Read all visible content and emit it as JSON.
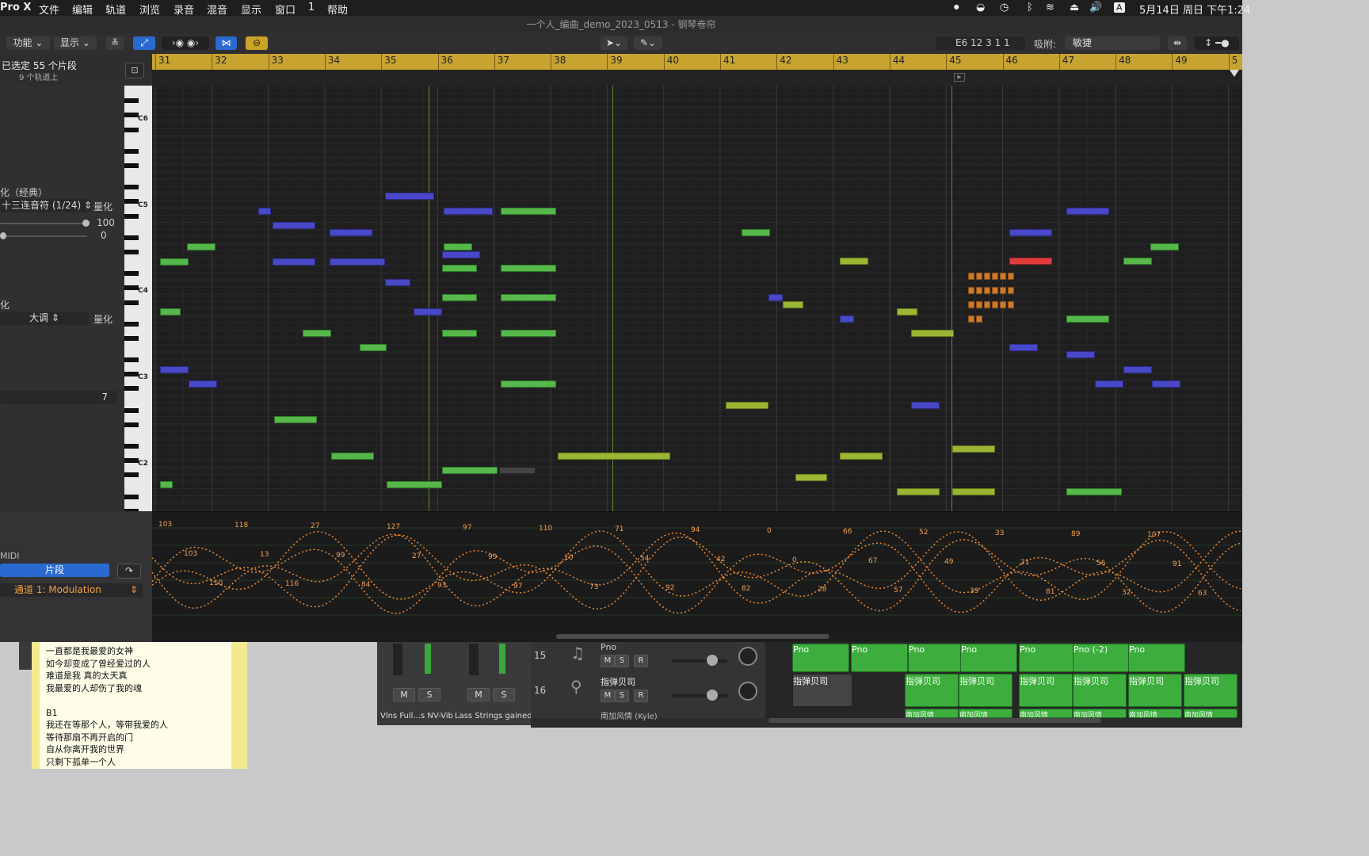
{
  "menubar": {
    "app": "Pro X",
    "items": [
      "文件",
      "编辑",
      "轨道",
      "浏览",
      "录音",
      "混音",
      "显示",
      "窗口",
      "1",
      "帮助"
    ],
    "status_icons": [
      "record-icon",
      "location-icon",
      "time-machine-icon",
      "bluetooth-icon",
      "wifi-icon",
      "eject-icon",
      "volume-icon",
      "input-source-icon"
    ],
    "input_source": "A",
    "clock": "5月14日 周日 下午1:24"
  },
  "window": {
    "title": "一个人_编曲_demo_2023_0513 - 钢琴卷帘"
  },
  "toolbar": {
    "function_label": "功能",
    "view_label": "显示",
    "position": "E6  12 3 1 1",
    "snap_label": "吸附:",
    "snap_value": "敏捷"
  },
  "inspector": {
    "selected": "已选定 55 个片段",
    "on_tracks": "9 个轨道上",
    "quantize_style": "化（经典）",
    "quantize_value": "十三连音符 (1/24)",
    "quantize_btn": "量化",
    "strength_value": "100",
    "swing_value": "0",
    "scale_row_label": "化",
    "scale_value": "大调",
    "scale_quantize_btn": "量化",
    "velocity_value": "7",
    "midi_label": "MIDI",
    "region_tab": "片段",
    "automation_param": "通道 1: Modulation"
  },
  "ruler": {
    "bars": [
      "31",
      "32",
      "33",
      "34",
      "35",
      "36",
      "37",
      "38",
      "39",
      "40",
      "41",
      "42",
      "43",
      "44",
      "45",
      "46",
      "47",
      "48",
      "49",
      "5"
    ]
  },
  "keyboard": {
    "octave_labels": [
      "C6",
      "C5",
      "C4",
      "C3",
      "C2"
    ]
  },
  "automation": {
    "values": [
      "103",
      "103",
      "110",
      "118",
      "13",
      "116",
      "27",
      "99",
      "84",
      "127",
      "27",
      "93",
      "97",
      "99",
      "97",
      "110",
      "10",
      "73",
      "71",
      "54",
      "92",
      "94",
      "42",
      "82",
      "0",
      "0",
      "28",
      "66",
      "67",
      "57",
      "52",
      "49",
      "39",
      "33",
      "21",
      "81",
      "89",
      "56",
      "32",
      "107",
      "91",
      "63"
    ]
  },
  "lyrics": {
    "lines": [
      "一直都是我最爱的女神",
      "如今却变成了曾经爱过的人",
      "难道是我 真的太天真",
      "我最爱的人却伤了我的魂",
      "",
      "B1",
      "我还在等那个人，等带我爱的人",
      "等待那扇不再开启的门",
      "自从你离开我的世界",
      "只剩下孤单一个人"
    ]
  },
  "mixer": {
    "ch1": {
      "name": "Vlns Full...s NV-Vib",
      "mute": "M",
      "solo": "S"
    },
    "ch2": {
      "name": "Lass Strings gained",
      "mute": "M",
      "solo": "S"
    }
  },
  "tracks": [
    {
      "num": "15",
      "name": "Pno",
      "m": "M",
      "s": "S",
      "r": "R"
    },
    {
      "num": "16",
      "name": "指弹贝司",
      "m": "M",
      "s": "S",
      "r": "R"
    },
    {
      "num": "",
      "name": "南加风情 (Kyle)"
    }
  ],
  "regions": {
    "row15": [
      "Pno",
      "Pno",
      "Pno",
      "Pno",
      "Pno",
      "Pno (-2)",
      "Pno"
    ],
    "row16": [
      "指弹贝司",
      "指弹贝司",
      "指弹贝司",
      "指弹贝司",
      "指弹贝司",
      "指弹贝司",
      "指弹贝司"
    ],
    "row17": [
      "南加风情",
      "南加风情",
      "南加风情",
      "南加风情",
      "南加风情",
      "南加风情"
    ]
  },
  "colors": {
    "ruler": "#c7a330",
    "blue_note": "#4848c8",
    "green_note": "#56b84a",
    "yellow_note": "#9ab632",
    "red_note": "#e03a3a",
    "automation": "#f08a30"
  }
}
